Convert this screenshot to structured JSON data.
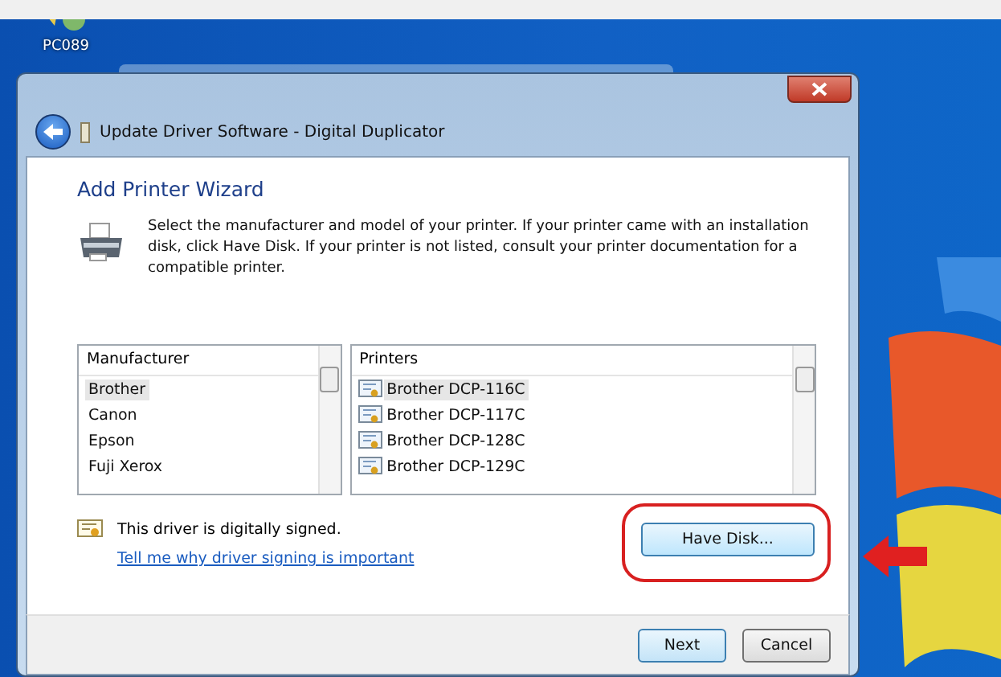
{
  "desktop": {
    "icon_label": "PC089"
  },
  "window": {
    "title": "Update Driver Software -  Digital Duplicator"
  },
  "wizard": {
    "heading": "Add Printer Wizard",
    "description": "Select the manufacturer and model of your printer. If your printer came with an installation disk, click Have Disk. If your printer is not listed, consult your printer documentation for a compatible printer."
  },
  "manufacturer_list": {
    "header": "Manufacturer",
    "items": [
      {
        "label": "Brother",
        "selected": true
      },
      {
        "label": "Canon",
        "selected": false
      },
      {
        "label": "Epson",
        "selected": false
      },
      {
        "label": "Fuji Xerox",
        "selected": false
      }
    ]
  },
  "printer_list": {
    "header": "Printers",
    "items": [
      {
        "label": "Brother DCP-116C",
        "selected": true
      },
      {
        "label": "Brother DCP-117C",
        "selected": false
      },
      {
        "label": "Brother DCP-128C",
        "selected": false
      },
      {
        "label": "Brother DCP-129C",
        "selected": false
      }
    ]
  },
  "signing": {
    "text": "This driver is digitally signed.",
    "link": "Tell me why driver signing is important"
  },
  "have_disk_button": "Have Disk...",
  "buttons": [
    {
      "label": "Next",
      "kind": "default"
    },
    {
      "label": "Cancel",
      "kind": "normal"
    }
  ]
}
